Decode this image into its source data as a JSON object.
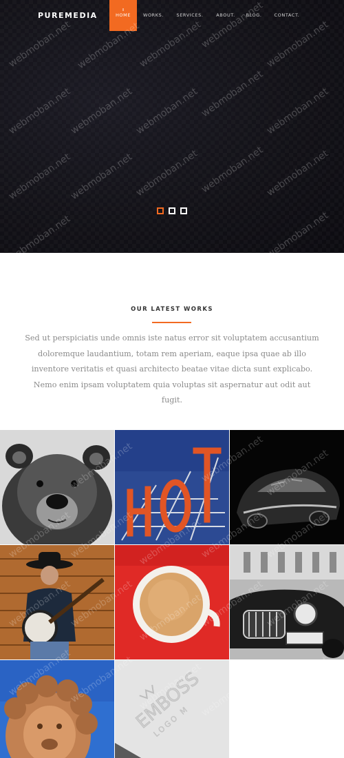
{
  "brand": {
    "logo": "PUREMEDIA",
    "accent": "#f26a21"
  },
  "nav": {
    "items": [
      {
        "label": "HOME",
        "active": true
      },
      {
        "label": "WORKS."
      },
      {
        "label": "SERVICES."
      },
      {
        "label": "ABOUT."
      },
      {
        "label": "BLOG."
      },
      {
        "label": "CONTACT."
      }
    ]
  },
  "slider": {
    "slides": 3,
    "active_index": 0
  },
  "works": {
    "title": "OUR LATEST WORKS",
    "description": "Sed ut perspiciatis unde omnis iste natus error sit voluptatem accusantium doloremque laudantium, totam rem aperiam, eaque ipsa quae ab illo inventore veritatis et quasi architecto beatae vitae dicta sunt explicabo. Nemo enim ipsam voluptatem quia voluptas sit aspernatur aut odit aut fugit."
  },
  "gallery": {
    "tiles": [
      {
        "name": "bear"
      },
      {
        "name": "hot-sign"
      },
      {
        "name": "dark-car"
      },
      {
        "name": "banjo-player"
      },
      {
        "name": "coffee-cup"
      },
      {
        "name": "vintage-car"
      },
      {
        "name": "lion-statue"
      },
      {
        "name": "emboss-logo",
        "text": "EMBOSS",
        "subtext": "LOGO M"
      }
    ]
  },
  "watermark": {
    "text": "webmoban.net"
  }
}
